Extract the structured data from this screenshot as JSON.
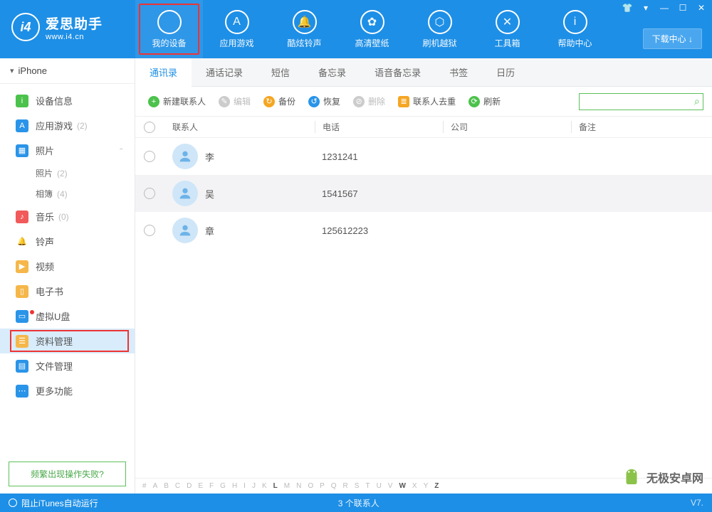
{
  "app": {
    "title": "爱思助手",
    "url": "www.i4.cn",
    "download_center": "下载中心 ↓"
  },
  "topnav": [
    {
      "label": "我的设备",
      "icon": "",
      "highlight": true
    },
    {
      "label": "应用游戏",
      "icon": "A"
    },
    {
      "label": "酷炫铃声",
      "icon": "🔔"
    },
    {
      "label": "高清壁纸",
      "icon": "✿"
    },
    {
      "label": "刷机越狱",
      "icon": "⬡"
    },
    {
      "label": "工具箱",
      "icon": "✕"
    },
    {
      "label": "帮助中心",
      "icon": "i"
    }
  ],
  "sidebar": {
    "device": "iPhone",
    "items": [
      {
        "label": "设备信息",
        "color": "#4cc24c",
        "glyph": "i"
      },
      {
        "label": "应用游戏",
        "count": "(2)",
        "color": "#2a94e8",
        "glyph": "A"
      },
      {
        "label": "照片",
        "color": "#2a94e8",
        "glyph": "▦",
        "expanded": true,
        "subs": [
          {
            "label": "照片",
            "count": "(2)"
          },
          {
            "label": "相簿",
            "count": "(4)"
          }
        ]
      },
      {
        "label": "音乐",
        "count": "(0)",
        "color": "#f15a5a",
        "glyph": "♪"
      },
      {
        "label": "铃声",
        "color": "#2a94e8",
        "glyph": "🔔",
        "icononly": true
      },
      {
        "label": "视频",
        "color": "#f5b74a",
        "glyph": "▶"
      },
      {
        "label": "电子书",
        "color": "#f5b74a",
        "glyph": "▯"
      },
      {
        "label": "虚拟U盘",
        "color": "#2a94e8",
        "glyph": "▭",
        "dot": true
      },
      {
        "label": "资料管理",
        "color": "#f5b74a",
        "glyph": "☰",
        "selected": true,
        "highlight": true
      },
      {
        "label": "文件管理",
        "color": "#2a94e8",
        "glyph": "▤"
      },
      {
        "label": "更多功能",
        "color": "#2a94e8",
        "glyph": "⋯"
      }
    ],
    "help": "频繁出现操作失败?"
  },
  "tabs": [
    "通讯录",
    "通话记录",
    "短信",
    "备忘录",
    "语音备忘录",
    "书签",
    "日历"
  ],
  "active_tab": 0,
  "toolbar": {
    "new": "新建联系人",
    "edit": "编辑",
    "backup": "备份",
    "restore": "恢复",
    "delete": "删除",
    "dedupe": "联系人去重",
    "refresh": "刷新"
  },
  "columns": {
    "name": "联系人",
    "phone": "电话",
    "company": "公司",
    "note": "备注"
  },
  "contacts": [
    {
      "name": "李",
      "phone": "1231241"
    },
    {
      "name": "吴",
      "phone": "1541567"
    },
    {
      "name": "章",
      "phone": "125612223"
    }
  ],
  "alpha": [
    "#",
    "A",
    "B",
    "C",
    "D",
    "E",
    "F",
    "G",
    "H",
    "I",
    "J",
    "K",
    "L",
    "M",
    "N",
    "O",
    "P",
    "Q",
    "R",
    "S",
    "T",
    "U",
    "V",
    "W",
    "X",
    "Y",
    "Z"
  ],
  "alpha_on": [
    "L",
    "W",
    "Z"
  ],
  "footer": {
    "itunes": "阻止iTunes自动运行",
    "count": "3 个联系人",
    "version": "V7."
  },
  "watermark": "无极安卓网"
}
